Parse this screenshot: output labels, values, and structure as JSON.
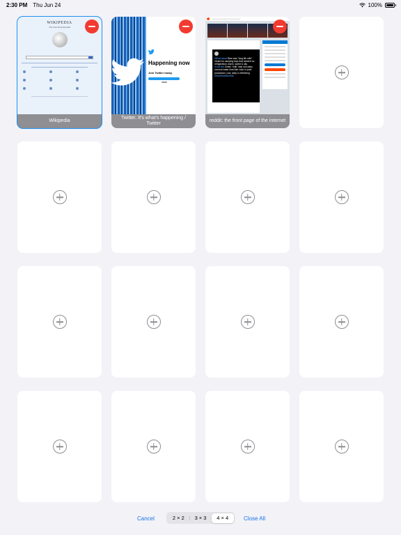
{
  "status_bar": {
    "time": "2:30 PM",
    "date": "Thu Jun 24",
    "battery": "100%"
  },
  "tabs": [
    {
      "caption": "Wikipedia",
      "selected": true,
      "type": "wikipedia"
    },
    {
      "caption": "Twitter. It's what's happening / Twitter",
      "selected": false,
      "type": "twitter"
    },
    {
      "caption": "reddit: the front page of the internet",
      "selected": false,
      "type": "reddit"
    }
  ],
  "wikipedia_thumb": {
    "wordmark": "WIKIPEDIA",
    "tagline": "The Free Encyclopedia"
  },
  "twitter_thumb": {
    "headline": "Happening now",
    "subhead": "Join Twitter today."
  },
  "reddit_thumb": {
    "tweet_author": "Blue Hawaii",
    "tweet_prefix": "",
    "tweet_text": "Blue was \"long life milk\" meant for camping trips that needed no refrigeration; warm, sweet & oily.",
    "tweet_text2": "Green \"milk\" was non-dairy coconut water lined like color in post-production; cool, tasty & refreshing",
    "hashtag1": "#BlueHawaii",
    "hashtag2": "#LastJedi",
    "hashtag3": "#StarWarsBlueMilk"
  },
  "empty_slot_count": 13,
  "toolbar": {
    "cancel": "Cancel",
    "close_all": "Close All",
    "layout_options": [
      "2 × 2",
      "3 × 3",
      "4 × 4"
    ],
    "selected_layout": "4 × 4"
  },
  "colors": {
    "accent": "#1a73e8",
    "remove_badge": "#f23b30",
    "selected_outline": "#1f8ff0",
    "caption_bg": "#8e8e93",
    "background": "#f2f2f7"
  }
}
